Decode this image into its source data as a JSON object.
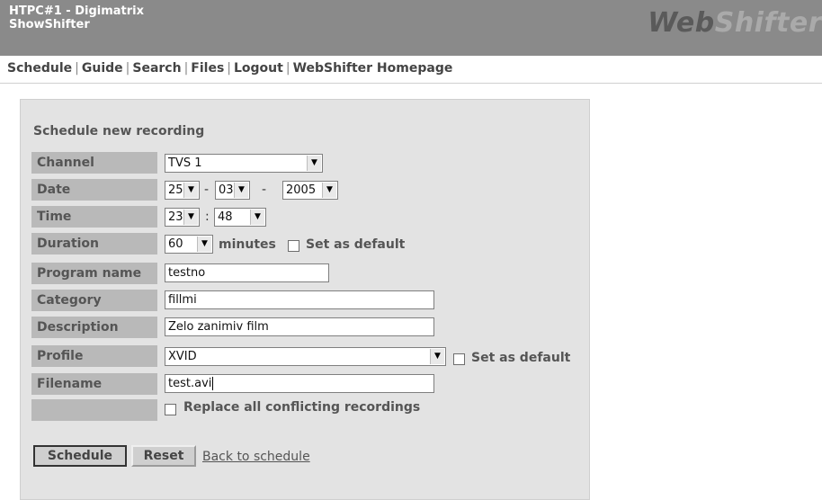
{
  "header": {
    "line1": "HTPC#1 - Digimatrix",
    "line2": "ShowShifter",
    "logo_part1": "Web",
    "logo_part2": "Shifter"
  },
  "nav": {
    "schedule": "Schedule",
    "guide": "Guide",
    "search": "Search",
    "files": "Files",
    "logout": "Logout",
    "homepage": "WebShifter Homepage",
    "separator": "|"
  },
  "form": {
    "title": "Schedule new recording",
    "labels": {
      "channel": "Channel",
      "date": "Date",
      "time": "Time",
      "duration": "Duration",
      "program_name": "Program name",
      "category": "Category",
      "description": "Description",
      "profile": "Profile",
      "filename": "Filename"
    },
    "channel": "TVS 1",
    "date_day": "25",
    "date_month": "03",
    "date_year": "2005",
    "date_sep": "-",
    "time_hour": "23",
    "time_minute": "48",
    "time_sep": ":",
    "duration": "60",
    "duration_unit": "minutes",
    "set_as_default": "Set as default",
    "program_name": "testno",
    "category": "fillmi",
    "description": "Zelo zanimiv film",
    "profile": "XVID",
    "filename": "test.avi",
    "replace_conflicts": "Replace all conflicting recordings"
  },
  "buttons": {
    "schedule": "Schedule",
    "reset": "Reset",
    "back": "Back to schedule"
  },
  "icons": {
    "dropdown": "chevron-down-icon"
  },
  "colors": {
    "header_bg": "#8a8a8a",
    "panel_bg": "#e3e3e3",
    "label_bg": "#b9b9b9"
  }
}
